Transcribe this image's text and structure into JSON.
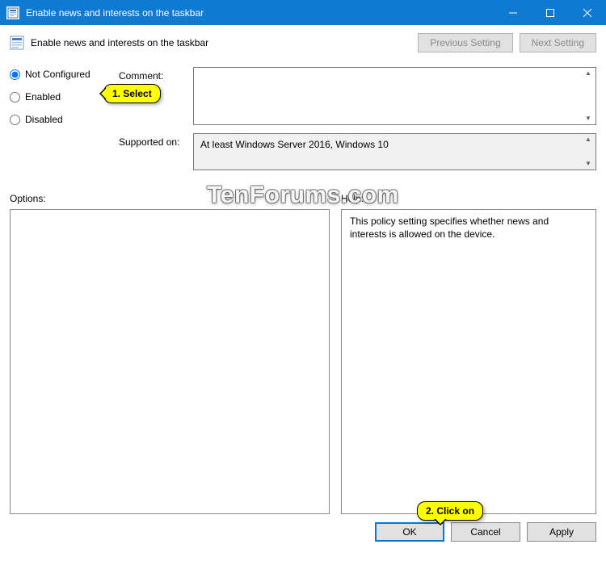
{
  "titlebar": {
    "title": "Enable news and interests on the taskbar"
  },
  "header": {
    "title": "Enable news and interests on the taskbar",
    "prev_btn": "Previous Setting",
    "next_btn": "Next Setting"
  },
  "radios": {
    "not_configured": "Not Configured",
    "enabled": "Enabled",
    "disabled": "Disabled"
  },
  "fields": {
    "comment_label": "Comment:",
    "comment_value": "",
    "supported_label": "Supported on:",
    "supported_value": "At least Windows Server 2016, Windows 10"
  },
  "sections": {
    "options_label": "Options:",
    "help_label": "Help:",
    "help_text": "This policy setting specifies whether news and interests is allowed on the device."
  },
  "buttons": {
    "ok": "OK",
    "cancel": "Cancel",
    "apply": "Apply"
  },
  "callouts": {
    "c1": "1. Select",
    "c2": "2. Click on"
  },
  "watermark": "TenForums.com"
}
